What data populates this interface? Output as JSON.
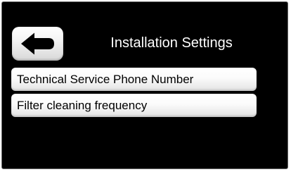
{
  "header": {
    "title": "Installation Settings",
    "back_icon": "back-arrow-icon"
  },
  "menu": {
    "items": [
      {
        "label": "Technical Service Phone Number"
      },
      {
        "label": "Filter cleaning frequency"
      }
    ]
  },
  "colors": {
    "background": "#000000",
    "text": "#ffffff",
    "button": "#f4f4f4",
    "icon": "#000000"
  }
}
